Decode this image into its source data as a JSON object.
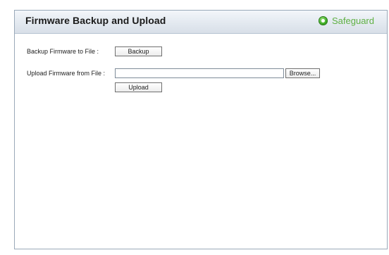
{
  "panel": {
    "title": "Firmware Backup and Upload",
    "safeguard_label": "Safeguard"
  },
  "backup": {
    "label": "Backup Firmware to File :",
    "button_label": "Backup"
  },
  "upload": {
    "label": "Upload Firmware from File :",
    "file_value": "",
    "browse_label": "Browse...",
    "button_label": "Upload"
  },
  "colors": {
    "safeguard_green": "#5fb043",
    "border": "#9aa9b9"
  }
}
